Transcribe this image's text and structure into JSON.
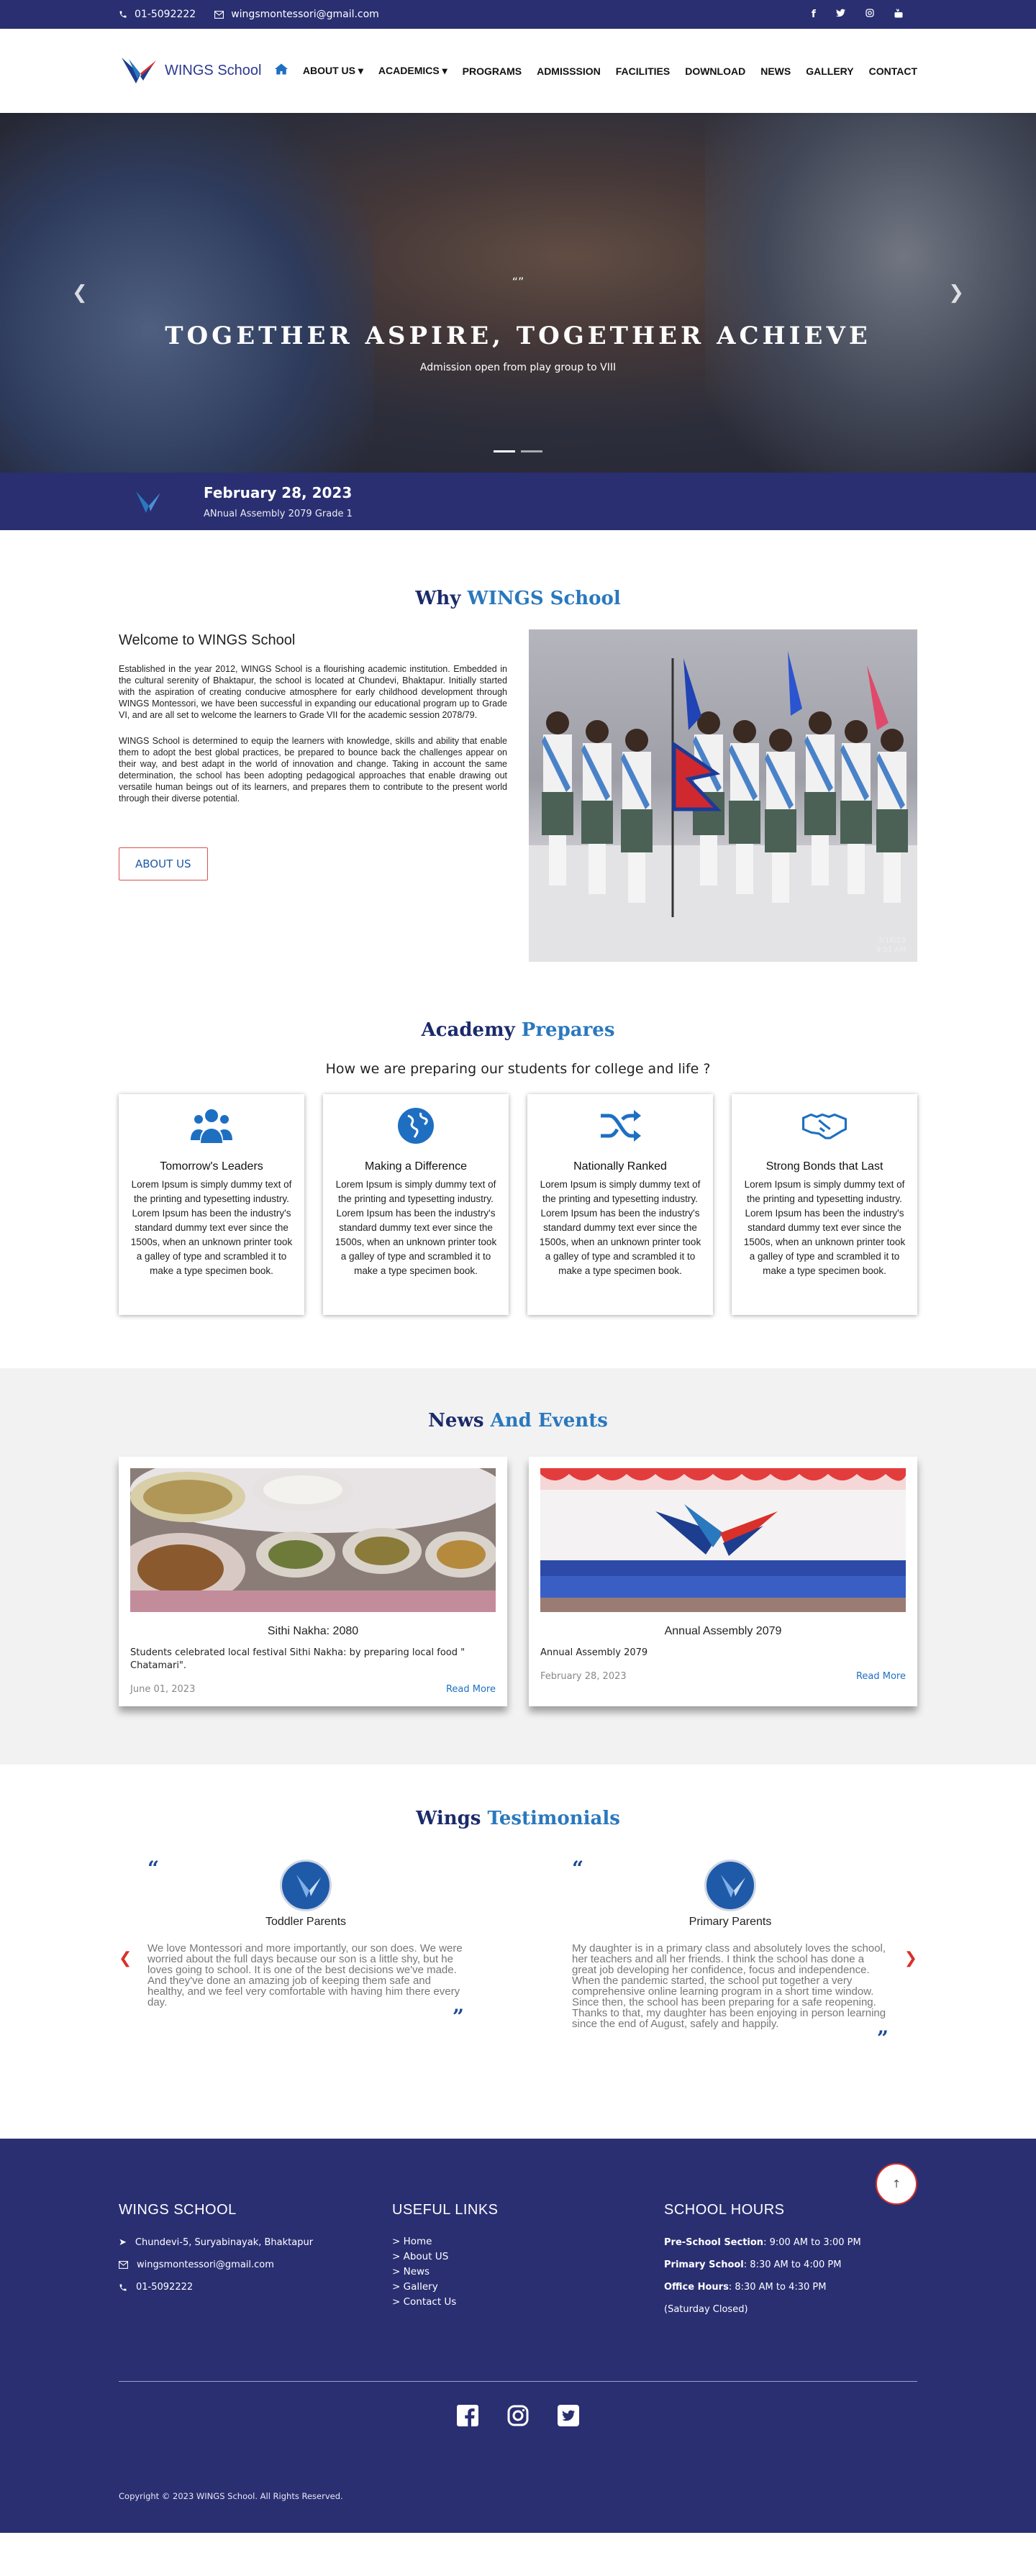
{
  "topbar": {
    "phone": "01-5092222",
    "email": "wingsmontessori@gmail.com",
    "social": [
      "f",
      "t",
      "ig",
      "yt"
    ]
  },
  "header": {
    "logo_text": "WINGS School",
    "nav": [
      "ABOUT US",
      "ACADEMICS",
      "PROGRAMS",
      "ADMISSSION",
      "FACILITIES",
      "DOWNLOAD",
      "NEWS",
      "GALLERY",
      "CONTACT"
    ]
  },
  "hero": {
    "mark": "“”",
    "title": "TOGETHER ASPIRE, TOGETHER ACHIEVE",
    "subtitle": "Admission open from play group to VIII"
  },
  "strip": {
    "date": "February 28, 2023",
    "title": "ANnual Assembly 2079 Grade 1"
  },
  "why": {
    "heading_a": "Why",
    "heading_b": "WINGS School",
    "welcome": "Welcome to WINGS School",
    "p1": "Established in the year 2012, WINGS School is a flourishing academic institution. Embedded in the cultural serenity of Bhaktapur, the school is located at Chundevi, Bhaktapur. Initially started with the aspiration of creating conducive atmosphere for early childhood development through WINGS Montessori, we have been successful in expanding our educational program up to Grade VI, and are all set to welcome the learners to Grade VII for the academic session 2078/79.",
    "p2": "WINGS School is determined to equip the learners with knowledge, skills and ability that enable them to adopt the best global practices, be prepared to bounce back the challenges appear on their way, and best adapt in the world of innovation and change.  Taking in account the same determination, the school has been adopting pedagogical approaches that enable drawing out versatile human beings out of its learners, and prepares them to contribute to the present world through their diverse potential.",
    "button": "ABOUT US",
    "photo_stamp_1": "3/16/23",
    "photo_stamp_2": "9:51 AM"
  },
  "prepares": {
    "heading_a": "Academy",
    "heading_b": "Prepares",
    "subheading": "How we are preparing our students for college and life ?",
    "cards": [
      {
        "icon": "users-icon",
        "title": "Tomorrow's Leaders",
        "text": "Lorem Ipsum is simply dummy text of the printing and typesetting industry. Lorem Ipsum has been the industry's standard dummy text ever since the 1500s, when an unknown printer took a galley of type and scrambled it to make a type specimen book."
      },
      {
        "icon": "globe-icon",
        "title": "Making a Difference",
        "text": "Lorem Ipsum is simply dummy text of the printing and typesetting industry. Lorem Ipsum has been the industry's standard dummy text ever since the 1500s, when an unknown printer took a galley of type and scrambled it to make a type specimen book."
      },
      {
        "icon": "shuffle-icon",
        "title": "Nationally Ranked",
        "text": "Lorem Ipsum is simply dummy text of the printing and typesetting industry. Lorem Ipsum has been the industry's standard dummy text ever since the 1500s, when an unknown printer took a galley of type and scrambled it to make a type specimen book."
      },
      {
        "icon": "handshake-icon",
        "title": "Strong Bonds that Last",
        "text": "Lorem Ipsum is simply dummy text of the printing and typesetting industry. Lorem Ipsum has been the industry's standard dummy text ever since the 1500s, when an unknown printer took a galley of type and scrambled it to make a type specimen book."
      }
    ]
  },
  "news": {
    "heading_a": "News",
    "heading_b": "And Events",
    "items": [
      {
        "title": "Sithi Nakha: 2080",
        "desc": "Students celebrated local festival Sithi Nakha: by preparing local food \" Chatamari\".",
        "date": "June 01, 2023",
        "link": "Read More"
      },
      {
        "title": "Annual Assembly 2079",
        "desc": "Annual Assembly 2079",
        "date": "February 28, 2023",
        "link": "Read More"
      }
    ]
  },
  "testimonials": {
    "heading_a": "Wings",
    "heading_b": "Testimonials",
    "items": [
      {
        "name": "Toddler Parents",
        "text": "We love Montessori and more importantly, our son does. We were worried about the full days because our son is a little shy, but he loves going to school. It is one of the best decisions we've made. And they've done an amazing job of keeping them safe and healthy, and we feel very comfortable with having him there every day."
      },
      {
        "name": "Primary Parents",
        "text": "My daughter is in a primary class and absolutely loves the school, her teachers and all her friends. I think the school has done a great job developing her confidence, focus and independence. When the pandemic started, the school put together a very comprehensive online learning program in a short time window. Since then, the school has been preparing for a safe reopening. Thanks to that, my daughter has been enjoying in person learning since the end of August, safely and happily."
      }
    ]
  },
  "footer": {
    "col1_title": "WINGS SCHOOL",
    "address": "Chundevi-5, Suryabinayak, Bhaktapur",
    "email": "wingsmontessori@gmail.com",
    "phone": "01-5092222",
    "col2_title": "USEFUL LINKS",
    "links": [
      "> Home",
      "> About US",
      "> News",
      "> Gallery",
      "> Contact Us"
    ],
    "col3_title": "SCHOOL HOURS",
    "hours": [
      {
        "label": "Pre-School Section",
        "value": ": 9:00 AM to 3:00 PM"
      },
      {
        "label": "Primary School",
        "value": ": 8:30 AM to 4:00 PM"
      },
      {
        "label": "Office Hours",
        "value": ": 8:30 AM to 4:30 PM"
      }
    ],
    "saturday": "(Saturday Closed)",
    "copyright": "Copyright © 2023 WINGS School. All Rights Reserved."
  }
}
